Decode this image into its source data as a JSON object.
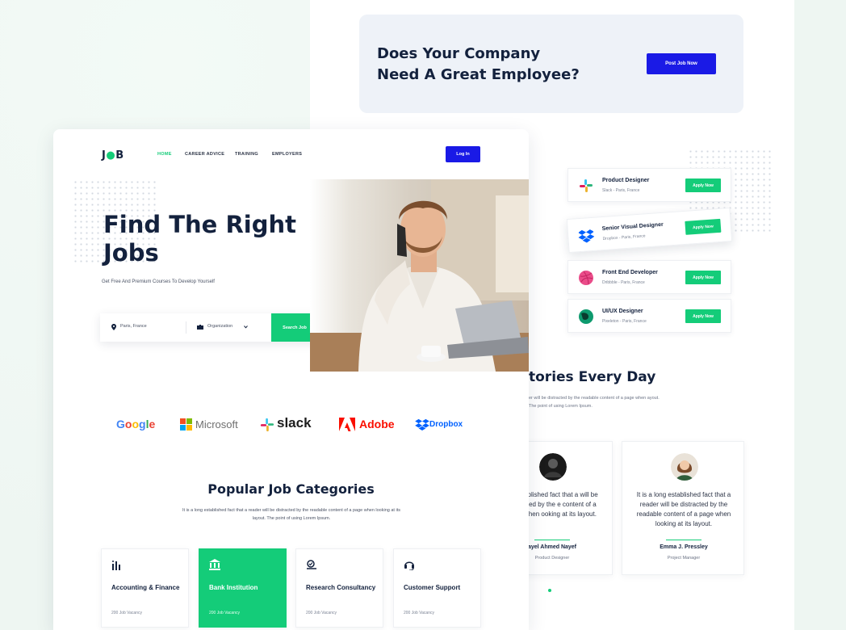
{
  "cta": {
    "title": "Does Your Company Need A Great Employee?",
    "button": "Post Job Now"
  },
  "jobs": [
    {
      "title": "Product Designer",
      "sub": "Slack - Paris, France",
      "apply": "Apply Now",
      "icon": "slack-icon"
    },
    {
      "title": "Senior Visual Designer",
      "sub": "Dropbox - Paris, France",
      "apply": "Apply Now",
      "icon": "dropbox-icon"
    },
    {
      "title": "Front End Developer",
      "sub": "Dribbble - Paris, France",
      "apply": "Apply Now",
      "icon": "dribbble-icon"
    },
    {
      "title": "UI/UX Designer",
      "sub": "Pixeleton - Paris, France",
      "apply": "Apply Now",
      "icon": "pixeleton-icon"
    }
  ],
  "stories": {
    "title": "tories Every Day",
    "desc": "er will be distracted by the readable content of a page when ayout. The point of using Lorem Ipsum.",
    "testimonials": [
      {
        "text": "ng established fact that a will be distracted by the e content of a page when ooking at its layout.",
        "name": "ayel Ahmed Nayef",
        "role": "Product Designer"
      },
      {
        "text": "It is a long established fact that a reader will be distracted by the readable content of a page when looking at its layout.",
        "name": "Emma J. Pressley",
        "role": "Project Manager"
      }
    ]
  },
  "header": {
    "logo_a": "J",
    "logo_b": "B",
    "nav": [
      "HOME",
      "CAREER ADVICE",
      "TRAINING",
      "EMPLOYERS"
    ],
    "login": "Log In"
  },
  "hero": {
    "title": "Find The Right Jobs",
    "subtitle": "Get Free And Premium Courses To Develop Yourself",
    "location": "Paris, France",
    "organization": "Organization",
    "search": "Search Job"
  },
  "brands": [
    "Google",
    "Microsoft",
    "slack",
    "Adobe",
    "Dropbox"
  ],
  "categories": {
    "title": "Popular Job Categories",
    "desc": "It is a long established fact that a reader will be distracted by the readable content of a page when looking at its layout. The point of using Lorem Ipsum.",
    "items": [
      {
        "name": "Accounting & Finance",
        "vacancy": "200 Job Vacancy",
        "icon": "chart-icon"
      },
      {
        "name": "Bank Institution",
        "vacancy": "200 Job Vacancy",
        "icon": "bank-icon"
      },
      {
        "name": "Research Consultancy",
        "vacancy": "200 Job Vacancy",
        "icon": "research-icon"
      },
      {
        "name": "Customer Support",
        "vacancy": "200 Job Vacancy",
        "icon": "headset-icon"
      }
    ]
  },
  "colors": {
    "accent": "#14cc79",
    "brand_blue": "#1a1ae6",
    "navy": "#13213d"
  }
}
